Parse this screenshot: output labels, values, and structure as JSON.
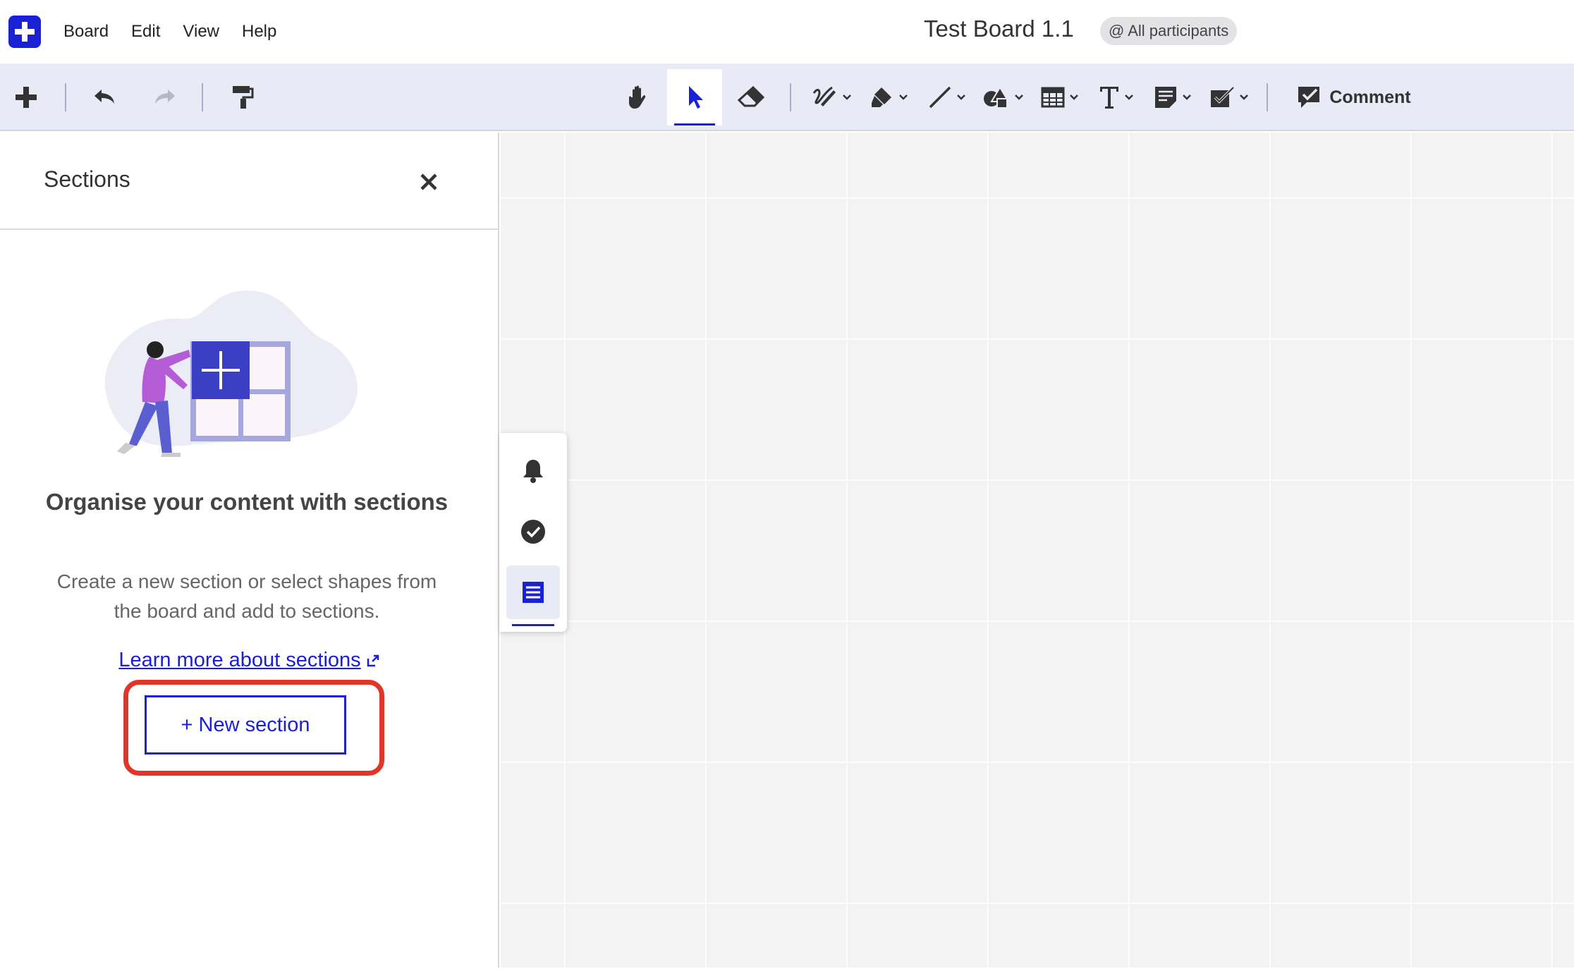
{
  "menubar": {
    "items": [
      "Board",
      "Edit",
      "View",
      "Help"
    ],
    "board_title": "Test Board 1.1",
    "participants_badge": "@ All participants"
  },
  "toolbar": {
    "tools": [
      "add",
      "undo",
      "redo",
      "format-painter",
      "hand",
      "select",
      "eraser",
      "pen",
      "highlighter",
      "line",
      "shapes",
      "table",
      "text",
      "sticky-note",
      "checklist",
      "comment"
    ],
    "active_tool": "select",
    "comment_label": "Comment"
  },
  "sections_panel": {
    "title": "Sections",
    "headline": "Organise your content with sections",
    "description": "Create a new section or select shapes from the board and add to sections.",
    "learn_more_link": "Learn more about sections",
    "new_section_button": "+ New section"
  },
  "side_dock": {
    "items": [
      "bell-icon",
      "check-circle-icon",
      "sections-list-icon"
    ],
    "active_item": "sections-list-icon"
  },
  "colors": {
    "accent": "#1a20d6",
    "toolbar_bg": "#e8eaf6",
    "highlight_annotation": "#e0362a"
  }
}
